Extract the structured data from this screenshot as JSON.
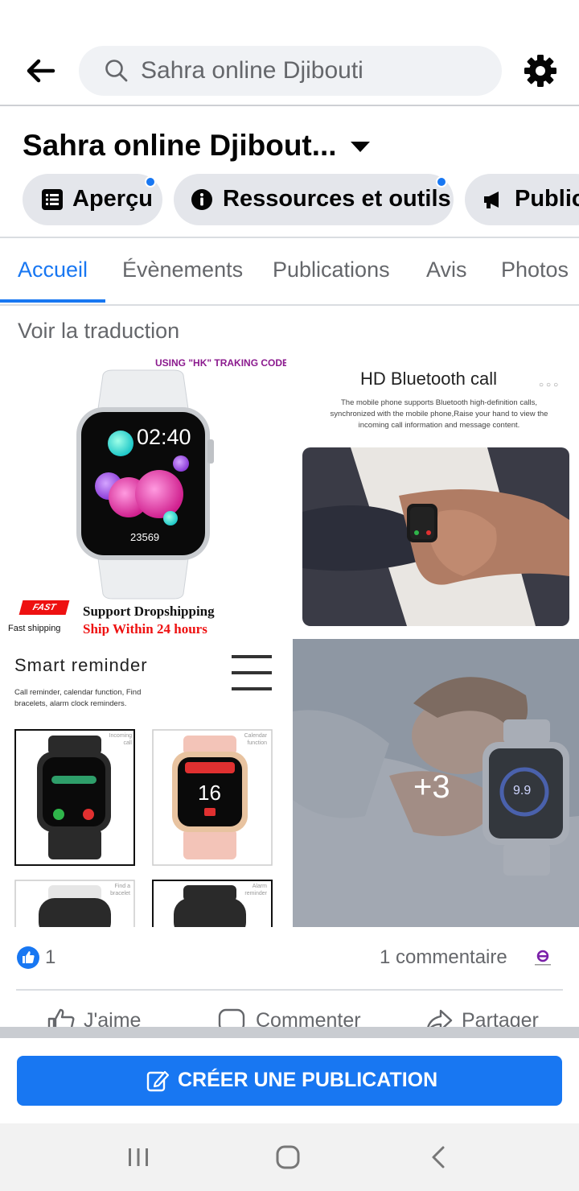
{
  "search": {
    "value": "Sahra online Djibouti"
  },
  "page": {
    "title": "Sahra online Djibout..."
  },
  "pills": [
    {
      "label": "Aperçu",
      "icon": "list-icon",
      "notification": true
    },
    {
      "label": "Ressources et outils",
      "icon": "info-icon",
      "notification": true
    },
    {
      "label": "Public",
      "icon": "megaphone-icon",
      "notification": false
    }
  ],
  "tabs": [
    {
      "label": "Accueil",
      "active": true
    },
    {
      "label": "Évènements",
      "active": false
    },
    {
      "label": "Publications",
      "active": false
    },
    {
      "label": "Avis",
      "active": false
    },
    {
      "label": "Photos",
      "active": false
    }
  ],
  "post": {
    "translate_link": "Voir la traduction",
    "photos": {
      "p1": {
        "top_text": "USING \"HK\" TRAKING CODE",
        "time": "02:40",
        "steps": "23569",
        "badge": "FAST",
        "badge_sub": "Fast shipping",
        "line1": "Support  Dropshipping",
        "line2": "Ship Within 24 hours"
      },
      "p2": {
        "title": "HD Bluetooth call",
        "desc": "The mobile phone supports Bluetooth high-definition calls, synchronized with the mobile phone,Raise your hand to view the incoming call information and message content."
      },
      "p3": {
        "title": "Smart reminder",
        "desc": "Call reminder, calendar function, Find bracelets, alarm clock reminders.",
        "cards": [
          "Incoming call",
          "Calendar function",
          "Find a bracelet",
          "Alarm reminder"
        ],
        "date_number": "16"
      },
      "p4": {
        "overlay": "+3",
        "value": "9.9"
      }
    },
    "like_count": "1",
    "comment_count": "1 commentaire",
    "actions": {
      "like": "J'aime",
      "comment": "Commenter",
      "share": "Partager"
    }
  },
  "create_post": {
    "label": "CRÉER UNE PUBLICATION"
  },
  "colors": {
    "accent": "#1877f2",
    "secondary_text": "#65676b",
    "pill_bg": "#e4e6eb"
  }
}
